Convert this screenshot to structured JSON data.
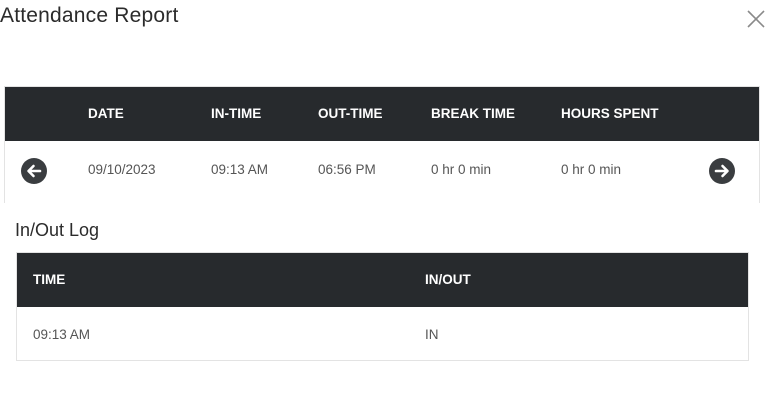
{
  "dialog": {
    "title": "Attendance Report"
  },
  "attendance": {
    "headers": {
      "date": "DATE",
      "in_time": "IN-TIME",
      "out_time": "OUT-TIME",
      "break_time": "BREAK TIME",
      "hours_spent": "HOURS SPENT"
    },
    "row": {
      "date": "09/10/2023",
      "in_time": "09:13 AM",
      "out_time": "06:56 PM",
      "break_time": "0 hr 0 min",
      "hours_spent": "0 hr 0 min"
    },
    "prev_icon": "arrow-left-circle-icon",
    "next_icon": "arrow-right-circle-icon"
  },
  "log": {
    "title": "In/Out Log",
    "headers": {
      "time": "TIME",
      "in_out": "IN/OUT"
    },
    "rows": [
      {
        "time": "09:13 AM",
        "in_out": "IN"
      }
    ]
  },
  "colors": {
    "header_bg": "#272a2d",
    "header_text": "#ffffff",
    "icon": "#3a3d40"
  }
}
